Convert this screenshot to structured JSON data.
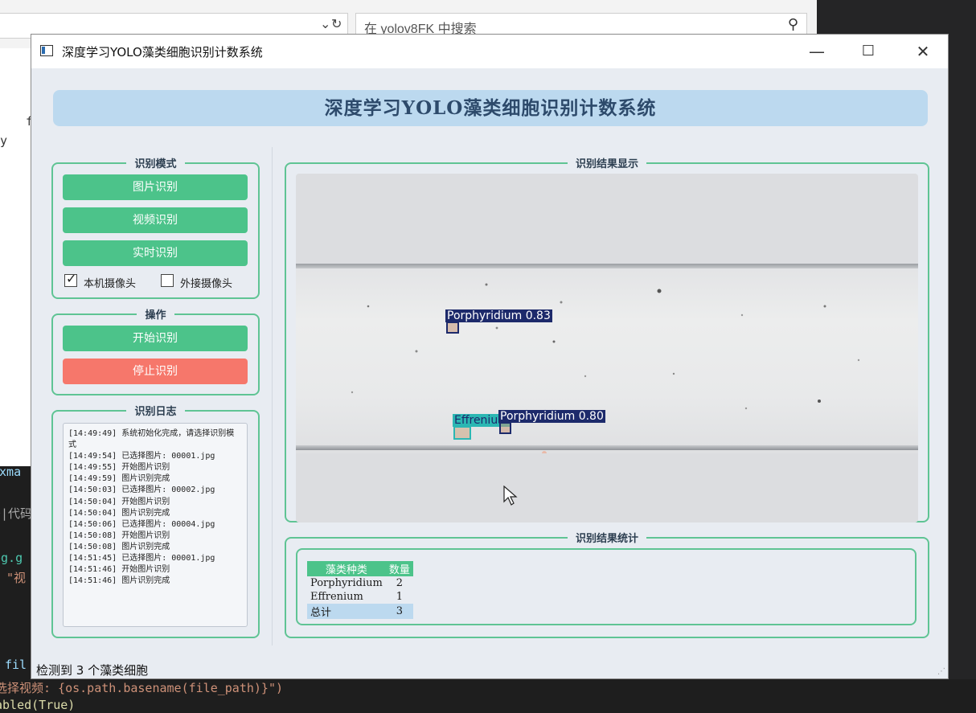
{
  "explorer": {
    "search_placeholder": "在 yolov8FK 中搜索",
    "dropdown_icon": "chevron-down-icon",
    "refresh_icon": "refresh-icon"
  },
  "code_fragments": {
    "line_f": "f",
    "line_y": "y",
    "line_xma": "ixma",
    "line_daima": "码|代码",
    "line_pg": "pg.g",
    "line_shi": "\"视",
    "line_fil": "fil",
    "line_select_video": "选择视频: {os.path.basename(file_path)}\")",
    "line_abled": "abled(True)"
  },
  "window": {
    "title": "深度学习YOLO藻类细胞识别计数系统",
    "minimize": "—",
    "maximize": "☐",
    "close": "✕"
  },
  "header": {
    "title": "深度学习YOLO藻类细胞识别计数系统"
  },
  "mode_group": {
    "legend": "识别模式",
    "image_btn": "图片识别",
    "video_btn": "视频识别",
    "realtime_btn": "实时识别",
    "local_cam": {
      "label": "本机摄像头",
      "checked": true
    },
    "external_cam": {
      "label": "外接摄像头",
      "checked": false
    }
  },
  "ops_group": {
    "legend": "操作",
    "start_btn": "开始识别",
    "stop_btn": "停止识别"
  },
  "log_group": {
    "legend": "识别日志",
    "lines": [
      "[14:49:49] 系统初始化完成，请选择识别模式",
      "[14:49:54] 已选择图片: 00001.jpg",
      "[14:49:55] 开始图片识别",
      "[14:49:59] 图片识别完成",
      "[14:50:03] 已选择图片: 00002.jpg",
      "[14:50:04] 开始图片识别",
      "[14:50:04] 图片识别完成",
      "[14:50:06] 已选择图片: 00004.jpg",
      "[14:50:08] 开始图片识别",
      "[14:50:08] 图片识别完成",
      "[14:51:45] 已选择图片: 00001.jpg",
      "[14:51:46] 开始图片识别",
      "[14:51:46] 图片识别完成"
    ]
  },
  "result_display": {
    "legend": "识别结果显示",
    "detections": [
      {
        "label": "Porphyridium 0.83",
        "class": "Porphyridium",
        "confidence": 0.83,
        "color": "#1d2a6b"
      },
      {
        "label": "Effrenium",
        "class": "Effrenium",
        "confidence": null,
        "color": "#2bb7b3"
      },
      {
        "label": "Porphyridium 0.80",
        "class": "Porphyridium",
        "confidence": 0.8,
        "color": "#1d2a6b"
      }
    ]
  },
  "stats_group": {
    "legend": "识别结果统计",
    "headers": [
      "藻类种类",
      "数量"
    ],
    "rows": [
      {
        "name": "Porphyridium",
        "count": "2"
      },
      {
        "name": "Effrenium",
        "count": "1"
      }
    ],
    "total": {
      "name": "总计",
      "count": "3"
    }
  },
  "status": {
    "text": "检测到 3 个藻类细胞"
  },
  "colors": {
    "accent_green": "#4cc38a",
    "stop_red": "#f6776b",
    "banner_blue": "#bcd9ef",
    "box_navy": "#1d2a6b",
    "box_teal": "#2bb7b3"
  }
}
